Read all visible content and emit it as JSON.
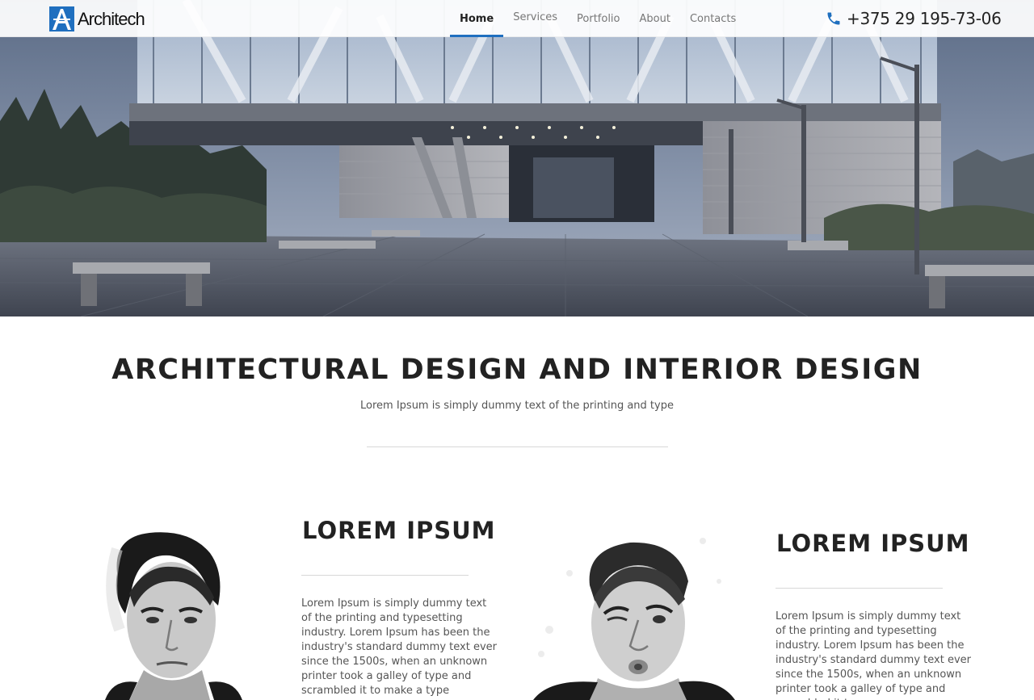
{
  "brand": {
    "name": "Architech",
    "logo_color": "#1f6fbf"
  },
  "nav": {
    "items": [
      {
        "label": "Home",
        "active": true
      },
      {
        "label": "Services",
        "active": false
      },
      {
        "label": "Portfolio",
        "active": false
      },
      {
        "label": "About",
        "active": false
      },
      {
        "label": "Contacts",
        "active": false
      }
    ],
    "accent_color": "#1f6fbf"
  },
  "contact": {
    "icon": "phone-icon",
    "phone": "+375 29 195-73-06"
  },
  "hero": {
    "image": "modern concrete building with glass upper floor and plaza"
  },
  "intro": {
    "title": "ARCHITECTURAL DESIGN AND INTERIOR DESIGN",
    "subtitle": "Lorem Ipsum is simply dummy text of the printing and type"
  },
  "profiles": [
    {
      "title": "LOREM IPSUM",
      "text": "Lorem Ipsum is simply dummy text of the printing and typesetting industry. Lorem Ipsum has been the industry's standard dummy text ever since the 1500s, when an unknown printer took a galley of type and scrambled it to make a type specimen book. It has"
    },
    {
      "title": "LOREM IPSUM",
      "text": "Lorem Ipsum is simply dummy text of the printing and typesetting industry. Lorem Ipsum has been the industry's standard dummy text ever since the 1500s, when an unknown printer took a galley of type and scrambled it to"
    }
  ]
}
